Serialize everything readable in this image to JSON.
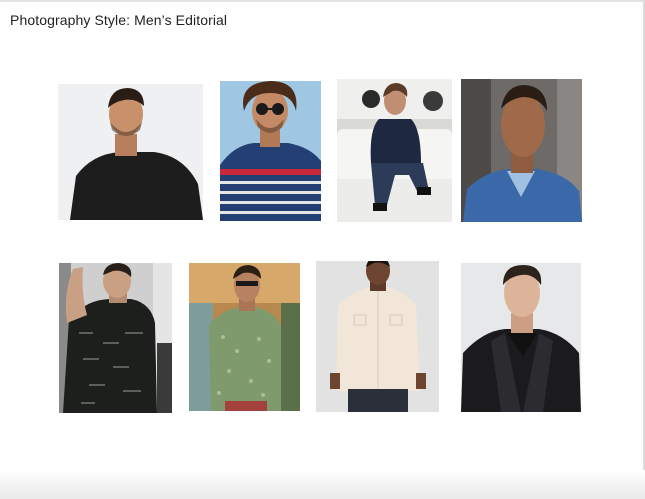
{
  "page": {
    "title": "Photography Style: Men’s Editorial"
  },
  "gallery": {
    "photos": [
      {
        "subject": "man in black long-sleeve top",
        "bg": "#eef0f2",
        "shirt": "#1d1d1d",
        "skin": "#c9906c",
        "hair": "#2a1d15"
      },
      {
        "subject": "man in red and navy striped tee with sunglasses",
        "bg": "#9fc7e4",
        "shirt": "#233f73",
        "accent": "#c8283a",
        "skin": "#c48a66",
        "hair": "#4a2c18"
      },
      {
        "subject": "man in navy blazer seated on white sofa",
        "bg": "#d9d9d6",
        "shirt": "#1e2840",
        "skin": "#c08f73",
        "hair": "#5a3c26"
      },
      {
        "subject": "man in denim shirt",
        "bg": "#6d6a68",
        "shirt": "#3a68a8",
        "skin": "#a06a4a",
        "hair": "#2b1c14"
      },
      {
        "subject": "man in black patterned tee",
        "bg": "#cfcfcf",
        "shirt": "#1c1f1c",
        "skin": "#caa084",
        "hair": "#2a1f18"
      },
      {
        "subject": "man in green printed short-sleeve shirt",
        "bg": "#b8894e",
        "shirt": "#7f9a6c",
        "skin": "#b88262",
        "hair": "#2d1e14"
      },
      {
        "subject": "man in cream button-up shirt",
        "bg": "#e2e2e2",
        "shirt": "#f1e6d8",
        "skin": "#6d4430",
        "hair": "#1b120c"
      },
      {
        "subject": "man in black leather jacket",
        "bg": "#e6e8e9",
        "shirt": "#1b1b1e",
        "skin": "#ddb49a",
        "hair": "#2d231d"
      }
    ]
  }
}
